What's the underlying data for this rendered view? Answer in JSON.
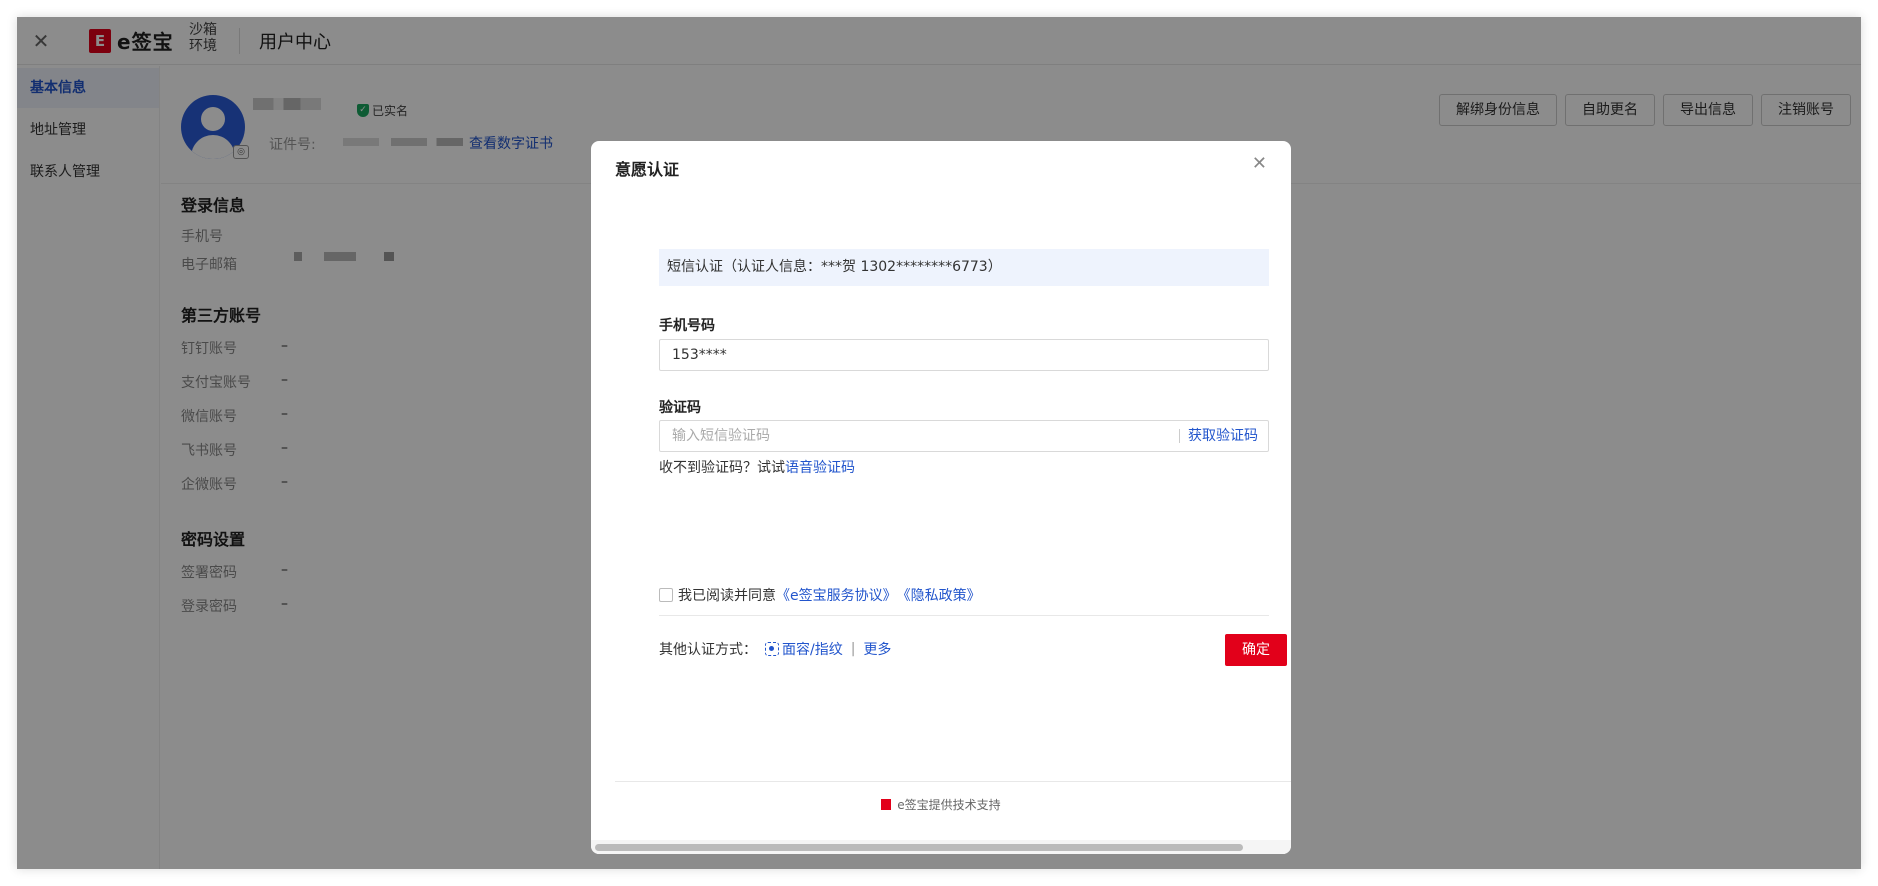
{
  "topbar": {
    "brand": "e签宝",
    "env_label": "沙箱环境",
    "page_title": "用户中心"
  },
  "sidebar": {
    "items": [
      {
        "label": "基本信息"
      },
      {
        "label": "地址管理"
      },
      {
        "label": "联系人管理"
      }
    ]
  },
  "profile": {
    "verified_label": "已实名",
    "cert_label": "证件号:",
    "view_cert_link": "查看数字证书",
    "actions": [
      "解绑身份信息",
      "自助更名",
      "导出信息",
      "注销账号"
    ]
  },
  "login_info": {
    "title": "登录信息",
    "phone_label": "手机号",
    "email_label": "电子邮箱"
  },
  "third_party": {
    "title": "第三方账号",
    "rows": [
      {
        "label": "钉钉账号",
        "value": "–"
      },
      {
        "label": "支付宝账号",
        "value": "–"
      },
      {
        "label": "微信账号",
        "value": "–"
      },
      {
        "label": "飞书账号",
        "value": "–"
      },
      {
        "label": "企微账号",
        "value": "–"
      }
    ]
  },
  "password": {
    "title": "密码设置",
    "rows": [
      {
        "label": "签署密码",
        "value": "–"
      },
      {
        "label": "登录密码",
        "value": "–"
      }
    ]
  },
  "modal": {
    "title": "意愿认证",
    "sms_banner": "短信认证（认证人信息：***贺 1302********6773）",
    "phone_label": "手机号码",
    "phone_value": "153****",
    "code_label": "验证码",
    "code_placeholder": "输入短信验证码",
    "get_code": "获取验证码",
    "no_code_prefix": "收不到验证码？试试",
    "voice_code": "语音验证码",
    "agree_prefix": "我已阅读并同意",
    "service_agreement": "《e签宝服务协议》",
    "privacy_policy": "《隐私政策》",
    "other_methods_label": "其他认证方式：",
    "face_method": "面容/指纹",
    "more": "更多",
    "confirm": "确定",
    "powered_by": "e签宝提供技术支持"
  }
}
